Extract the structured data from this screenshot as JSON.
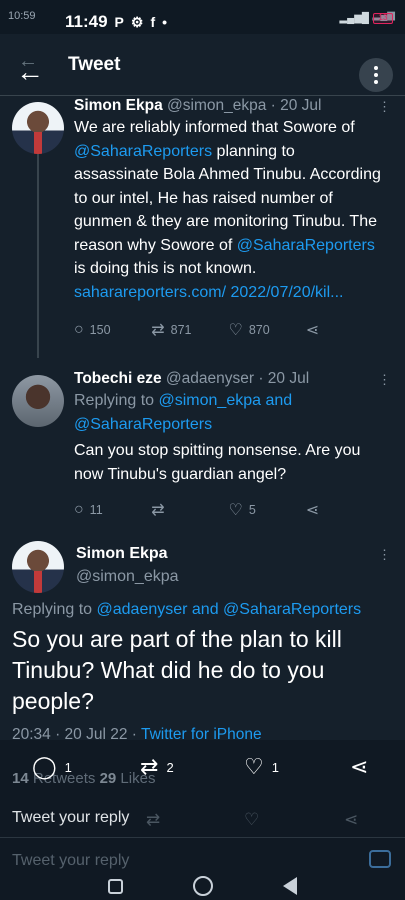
{
  "status_bar": {
    "time": "11:49",
    "icons": [
      "p-app-icon",
      "gear-icon",
      "facebook-icon",
      "dot-icon"
    ],
    "battery": "13"
  },
  "ghost_status": {
    "time": "10:59"
  },
  "header": {
    "title": "Tweet"
  },
  "tweets": [
    {
      "name": "Simon Ekpa",
      "handle": "@simon_ekpa",
      "date": "· 20 Jul",
      "text": {
        "p1": "We are reliably informed that Sowore of ",
        "m1": "@SaharaReporters",
        "p2": " planning to assassinate Bola Ahmed Tinubu. According to our intel, He has raised number of gunmen & they are monitoring Tinubu. The reason why Sowore of ",
        "m2": "@SaharaReporters",
        "p3": " is doing this is not known. ",
        "link": "saharareporters.com/ 2022/07/20/kil..."
      },
      "replies": "150",
      "retweets": "871",
      "likes": "870"
    },
    {
      "name": "Tobechi eze",
      "handle": "@adaenyser",
      "date": "· 20 Jul",
      "replying_prefix": "Replying to ",
      "replying_to": "@simon_ekpa and @SaharaReporters",
      "text": "Can you stop spitting nonsense. Are you now Tinubu's guardian angel?",
      "replies": "11",
      "retweets": "",
      "likes": "5"
    }
  ],
  "main_tweet": {
    "name": "Simon Ekpa",
    "handle": "@simon_ekpa",
    "replying_prefix": "Replying to ",
    "replying_to": "@adaenyser and @SaharaReporters",
    "text": "So you are part of the plan to kill Tinubu? What did he do to you people?",
    "time": "20:34 · 20 Jul 22 · ",
    "source": "Twitter for iPhone",
    "retweets_count": "14",
    "retweets_label": "Retweets",
    "likes_count": "29",
    "likes_label": "Likes"
  },
  "bottom_actions": {
    "comments": "1",
    "shares": "2",
    "likes": "1"
  },
  "reply_placeholder": "Tweet your reply",
  "reply_placeholder_ghost": "Tweet your reply",
  "colors": {
    "background": "#15202b",
    "link": "#1d9bf0",
    "muted": "#8b98a5",
    "battery": "#e0245e"
  }
}
